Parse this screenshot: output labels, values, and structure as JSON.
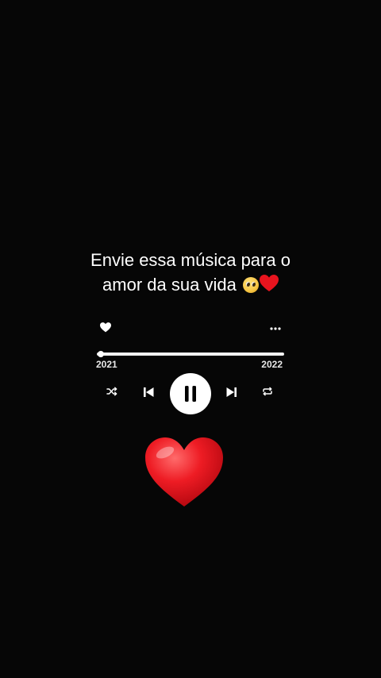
{
  "caption": {
    "line1": "Envie essa música para o",
    "line2": "amor da sua vida"
  },
  "player": {
    "time_start": "2021",
    "time_end": "2022",
    "progress": 0.02,
    "state": "playing",
    "icons": [
      "heart-icon",
      "more-icon",
      "shuffle-icon",
      "previous-icon",
      "pause-icon",
      "next-icon",
      "repeat-icon"
    ]
  },
  "colors": {
    "background": "#060606",
    "foreground": "#ffffff",
    "heart_red": "#e8141e"
  }
}
